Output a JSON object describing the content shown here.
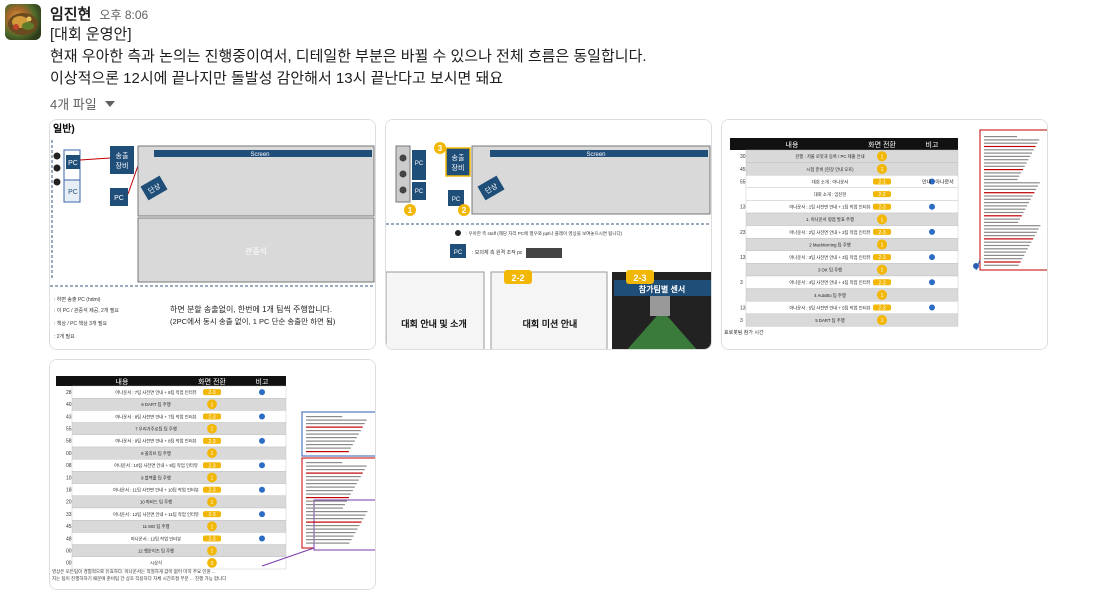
{
  "message": {
    "author": "임진현",
    "time": "오후 8:06",
    "lines": [
      "[대회 운영안]",
      "현재 우아한 측과 논의는 진행중이여서, 디테일한 부분은 바뀔 수 있으나 전체 흐름은 동일합니다.",
      "이상적으론 12시에 끝나지만 돌발성 감안해서 13시 끝난다고 보시면 돼요"
    ],
    "files_label": "4개 파일"
  },
  "thumb1": {
    "title": "일반)",
    "screen": "Screen",
    "pc": "PC",
    "equip": [
      "송출",
      "장비"
    ],
    "stage": "단상",
    "audience": "관중석",
    "note1": "하면 분할 송출없이, 한번에 1개 팀씩 주행합니다.",
    "note2": "(2PC에서 동시 송출 없이, 1 PC 단순 송출만 하면 됨)",
    "legend": [
      ": 하면 송출 PC (hdmi)",
      ": 이 PC / 관중석 제공, 2개 필요",
      ": 책상 / PC 책상 3개 필요",
      ": 2개 필요"
    ]
  },
  "thumb2": {
    "screen": "Screen",
    "pc": "PC",
    "equip": [
      "송출",
      "장비"
    ],
    "stage": "단상",
    "badges": [
      "1",
      "2",
      "3"
    ],
    "note1": ": 우아한 측 staff (제당 자리 PC에 행우와 ppt나 플레이 영상을 보여놓으시면 됩니다)",
    "note2": ": 모의체 측 원격 조작 pc",
    "slide_a_tag": "2-2",
    "slide_b_tag": "2-3",
    "slide1_title": "대회 안내 및 소개",
    "slide2_title": "대회 미션 안내",
    "slide3_title": "참가팀별 센서"
  },
  "thumb3": {
    "headers": [
      "내용",
      "화면 전환",
      "비고"
    ],
    "footer": "효로봇팀 참가 시간",
    "rows": [
      "진행 : 저울 로봇과 등록 / PC 제출 안내",
      "시험 준비 (현장 안내 오프)",
      "대회 소개 : 아나운서",
      "대회 소개 : 임진현",
      "아나운서 : 1팀 사전면 안내 + 1팀 작업 인터뷰",
      "1. 아나운서 평점 발표 주행",
      "아나운서 : 2팀 사전면 안내 + 2팀 작업 인터뷰",
      "2 MacMorning 팀 주행",
      "아나운서 : 3팀 사전면 안내 + 3팀 작업 인터뷰",
      "3 OK 팀 주행",
      "아나운서 : 4팀 사전면 안내 + 4팀 작업 인터뷰",
      "4 AutoBo 팀 주행",
      "아나운서 : 5팀 사전면 안내 + 5팀 작업 인터뷰",
      "5 DART 팀 주행"
    ],
    "times": [
      "30",
      "45",
      "55",
      "",
      "13",
      "",
      "23",
      "",
      "13",
      "",
      "3",
      "",
      "13",
      "3"
    ],
    "remarks": [
      "",
      "",
      "안내 : 아나운서",
      "",
      "",
      "",
      "",
      "",
      "",
      "",
      "",
      "",
      "",
      ""
    ],
    "tags": [
      "1",
      "1",
      "2-1",
      "2-2",
      "2-3",
      "1",
      "2-3",
      "1",
      "2-3",
      "1",
      "2-3",
      "1",
      "2-3",
      "1"
    ]
  },
  "thumb4": {
    "headers": [
      "내용",
      "화면 전환",
      "비고"
    ],
    "rows": [
      "아나운서 : 7팀 사전면 안내 + 8팀 작업 인터뷰",
      "6 DART 팀 주행",
      "아나운서 : 8팀 사전면 안내 + 7팀 작업 인터뷰",
      "7 우리가주로팀 팀 주행",
      "아나운서 : 9팀 사전면 안내 + 8팀 작업 인터뷰",
      "8 올리브 팀 주행",
      "아나운서 : 10팀 사전면 안내 + 9팀 작업 인터뷰",
      "9 블랙홀 팀 주행",
      "아나운서 : 11팀 사전면 안내 + 10팀 작업 인터뷰",
      "10 파비드 팀 주행",
      "아나운서 : 12팀 사전면 안내 + 11팀 작업 인터뷰",
      "11 MO 팀 주행",
      "아나운서 : 12팀 작업 인터뷰",
      "12 행운이즈 팀 주행",
      "시상식"
    ],
    "times": [
      "28",
      "40",
      "43",
      "55",
      "58",
      "00",
      "08",
      "10",
      "18",
      "20",
      "33",
      "45",
      "48",
      "00",
      "00"
    ],
    "tags": [
      "2-3",
      "1",
      "2-3",
      "1",
      "2-3",
      "1",
      "2-3",
      "1",
      "2-3",
      "1",
      "2-3",
      "1",
      "2-3",
      "1",
      "3"
    ],
    "footer1": "영상은 모든팀이 경험적으로 유효하다. 아나운서는 적절하게 값이 없어 마치 주요 인원 ...",
    "footer2": "지는 팀이 진행하하기 때문에 준비팀 간 상호 작용하다 자체 시간조절 부분 ... 진행 가능 합니다"
  }
}
